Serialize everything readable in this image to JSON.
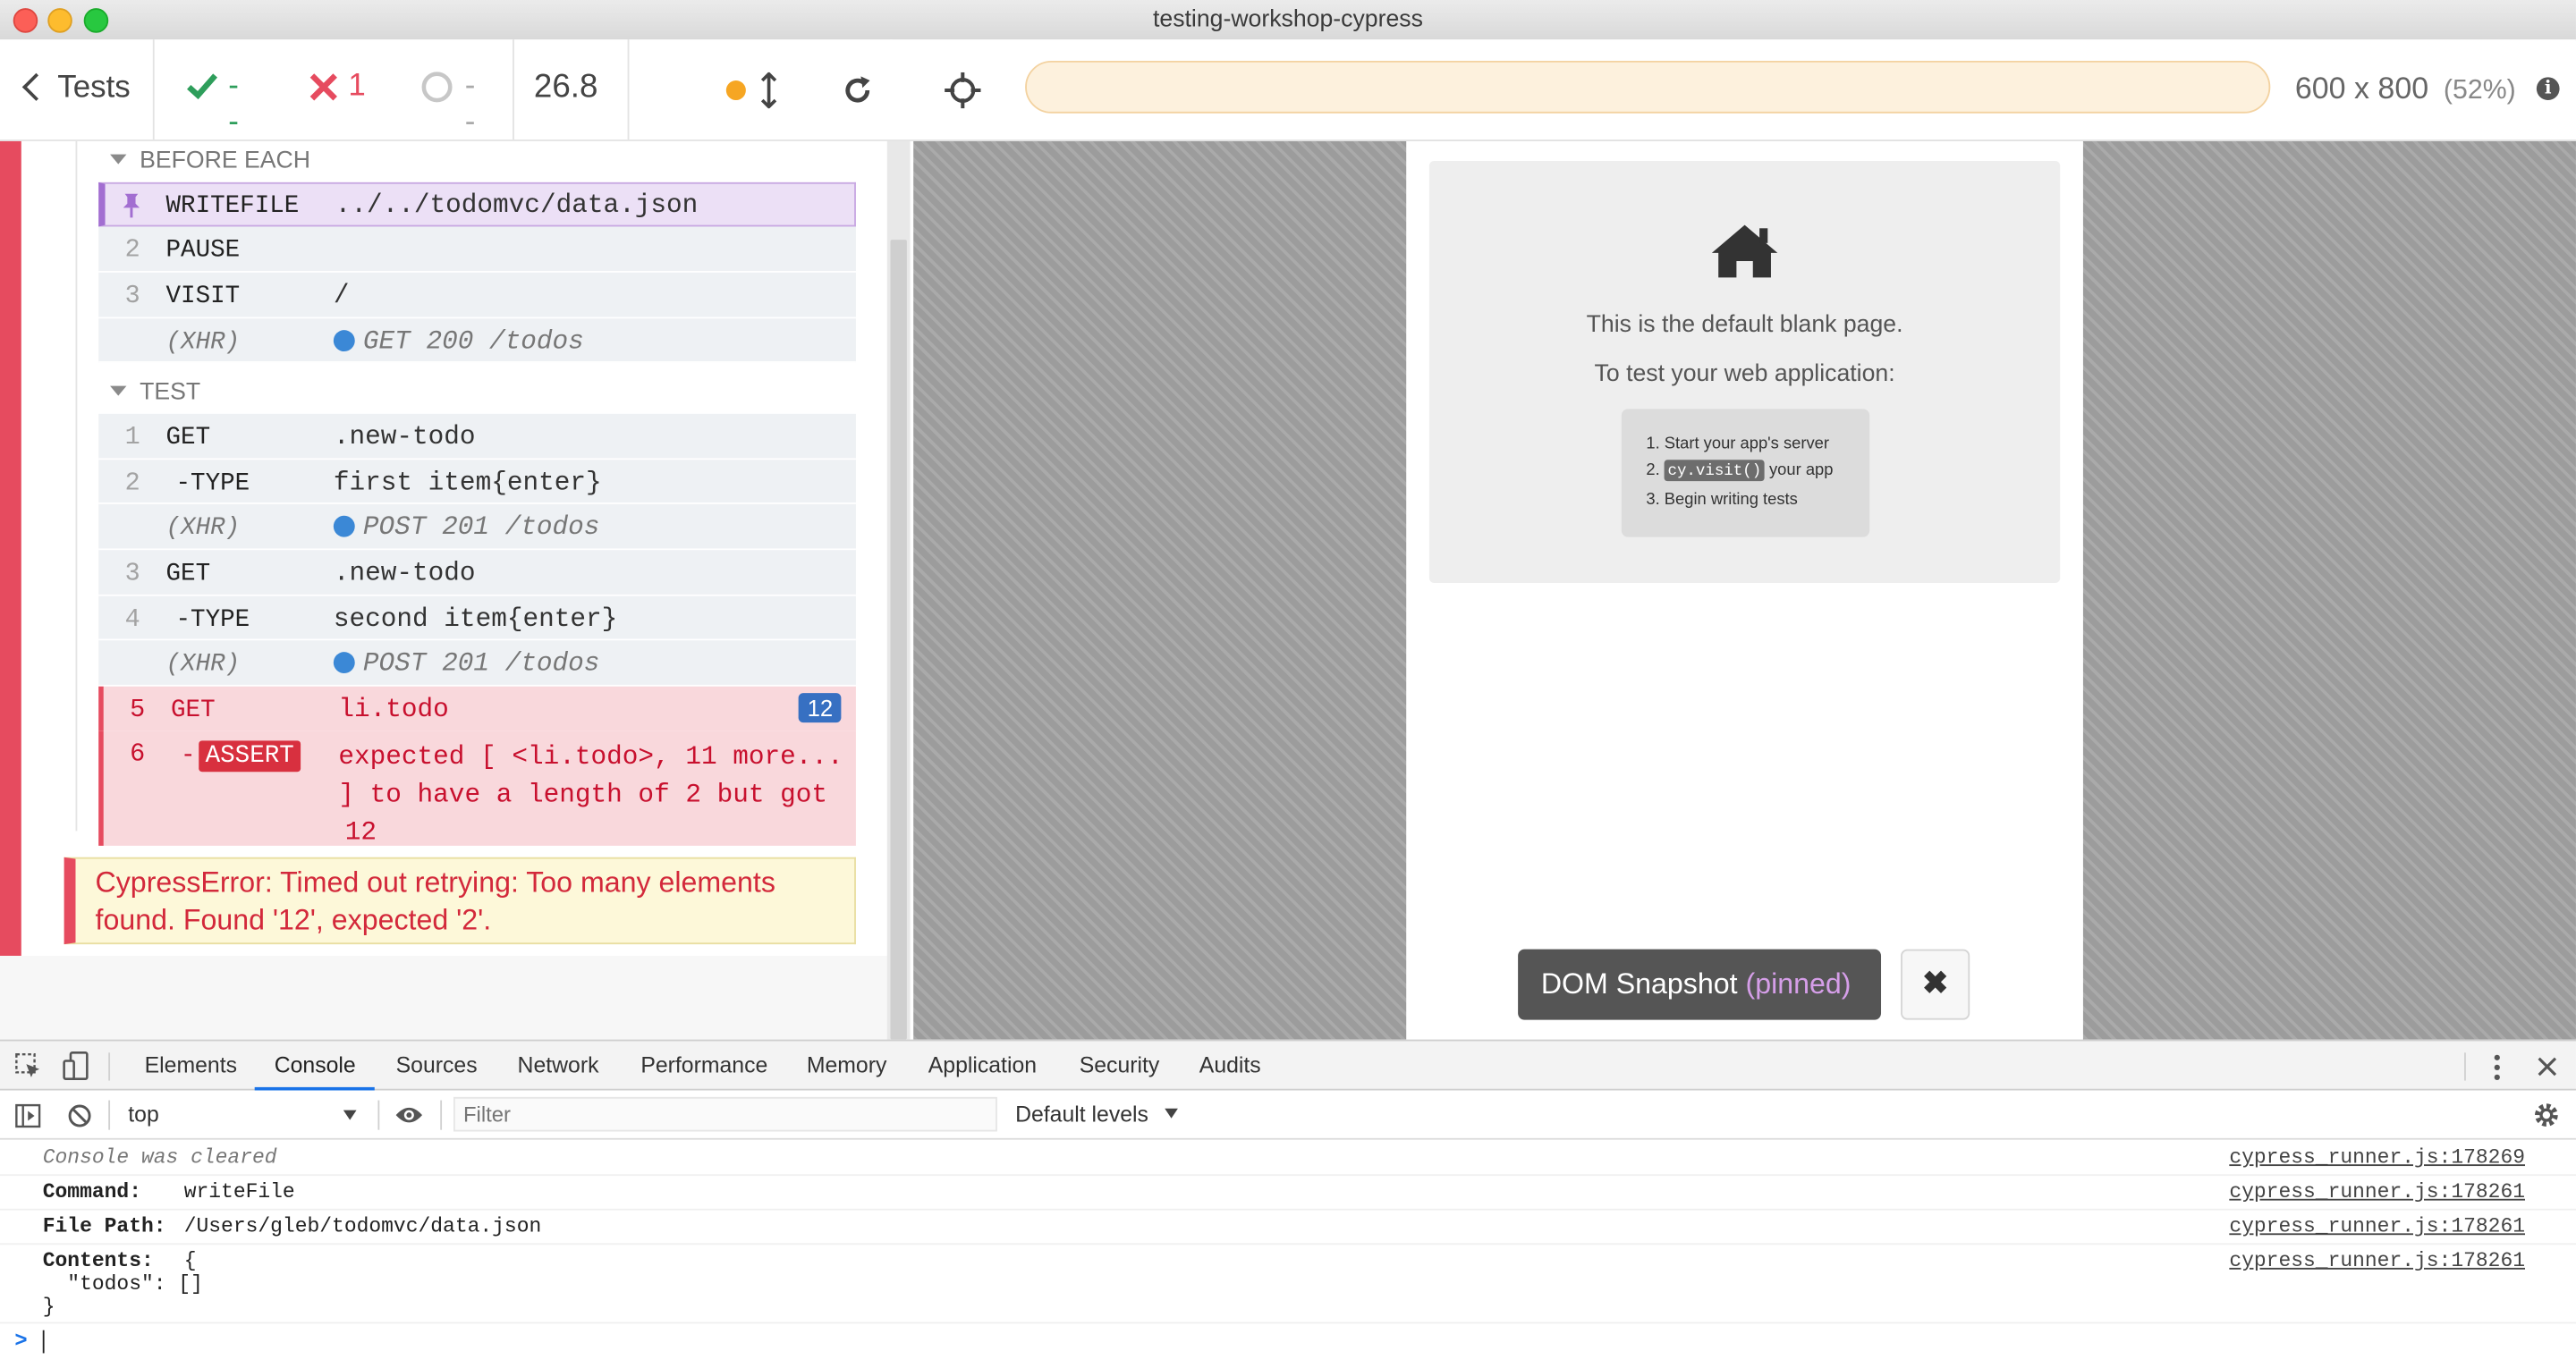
{
  "window": {
    "title": "testing-workshop-cypress"
  },
  "header": {
    "tests_label": "Tests",
    "passed_count": "--",
    "failed_count": "1",
    "pending_count": "--",
    "duration": "26.8",
    "viewport_size": "600 x 800",
    "viewport_scale": "(52%)",
    "url": ""
  },
  "reporter": {
    "before_each": {
      "title": "BEFORE EACH",
      "commands": [
        {
          "num": "",
          "name": "WRITEFILE",
          "message": "../../todomvc/data.json"
        },
        {
          "num": "2",
          "name": "PAUSE",
          "message": ""
        },
        {
          "num": "3",
          "name": "VISIT",
          "message": "/"
        },
        {
          "num": "",
          "name": "(XHR)",
          "message": "GET 200 /todos"
        }
      ]
    },
    "test": {
      "title": "TEST",
      "commands": [
        {
          "num": "1",
          "name": "GET",
          "message": ".new-todo"
        },
        {
          "num": "2",
          "name": "-TYPE",
          "message": "first item{enter}"
        },
        {
          "num": "",
          "name": "(XHR)",
          "message": "POST 201 /todos"
        },
        {
          "num": "3",
          "name": "GET",
          "message": ".new-todo"
        },
        {
          "num": "4",
          "name": "-TYPE",
          "message": "second item{enter}"
        },
        {
          "num": "",
          "name": "(XHR)",
          "message": "POST 201 /todos"
        },
        {
          "num": "5",
          "name": "GET",
          "message": "li.todo",
          "badge": "12"
        },
        {
          "num": "6",
          "name": "-",
          "badge_name": "ASSERT",
          "message_lines": [
            "expected [ <li.todo>, 11 more...",
            "] to have a length of 2 but got",
            "12"
          ]
        }
      ]
    },
    "error": {
      "lines": [
        "CypressError: Timed out retrying: Too many elements",
        "found. Found '12', expected '2'."
      ]
    }
  },
  "aut": {
    "blank_page": {
      "line1": "This is the default blank page.",
      "line2": "To test your web application:",
      "step1": "1. Start your app's server",
      "step2_prefix": "2.",
      "step2_code": "cy.visit()",
      "step2_suffix": "your app",
      "step3": "3. Begin writing tests"
    },
    "snapshot": {
      "label": "DOM Snapshot",
      "state": "(pinned)"
    }
  },
  "devtools": {
    "tabs": [
      "Elements",
      "Console",
      "Sources",
      "Network",
      "Performance",
      "Memory",
      "Application",
      "Security",
      "Audits"
    ],
    "active_tab": "Console",
    "context": "top",
    "filter_placeholder": "Filter",
    "levels": "Default levels",
    "console": [
      {
        "text": "Console was cleared",
        "source": "cypress_runner.js:178269"
      },
      {
        "key": "Command:",
        "value": "writeFile",
        "source": "cypress_runner.js:178261"
      },
      {
        "key": "File Path:",
        "value": "/Users/gleb/todomvc/data.json",
        "source": "cypress_runner.js:178261"
      },
      {
        "key": "Contents:",
        "value": "{",
        "value2": "  \"todos\": []",
        "value3": "}",
        "source": "cypress_runner.js:178261"
      }
    ],
    "prompt": ">"
  },
  "colors": {
    "failed": "#e64b5f",
    "passed": "#2e9e5b",
    "pending_dot": "#f6a623",
    "pinned": "#a26ed1",
    "badge": "#3770c2"
  }
}
